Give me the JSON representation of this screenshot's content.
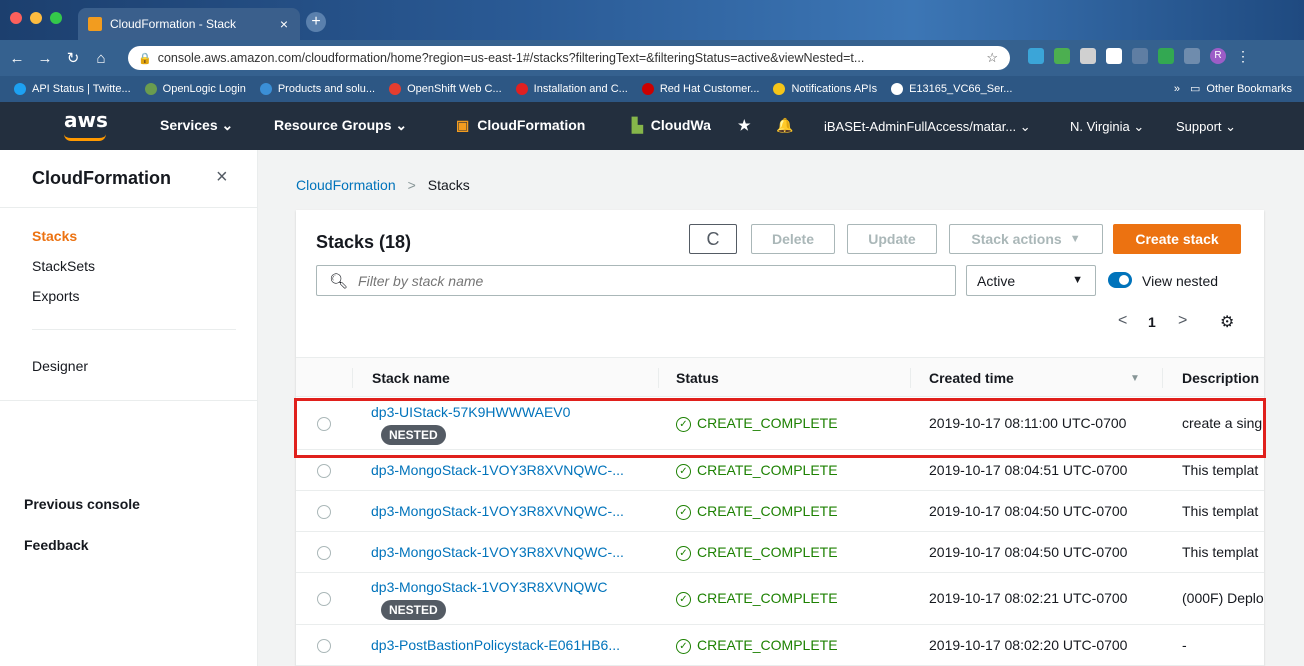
{
  "browser": {
    "tab_title": "CloudFormation - Stack",
    "tab_close": "×",
    "new_tab": "+",
    "url": "console.aws.amazon.com/cloudformation/home?region=us-east-1#/stacks?filteringText=&filteringStatus=active&viewNested=t...",
    "bookmarks": [
      "API Status | Twitte...",
      "OpenLogic Login",
      "Products and solu...",
      "OpenShift Web C...",
      "Installation and C...",
      "Red Hat Customer...",
      "Notifications APIs",
      "E13165_VC66_Ser..."
    ],
    "other_bookmarks": "Other Bookmarks",
    "overflow": "»",
    "profile_initial": "R"
  },
  "awsnav": {
    "logo": "aws",
    "services": "Services",
    "resource_groups": "Resource Groups",
    "cloudformation": "CloudFormation",
    "cloudwatch": "CloudWa",
    "account": "iBASEt-AdminFullAccess/matar...",
    "region": "N. Virginia",
    "support": "Support"
  },
  "sidebar": {
    "title": "CloudFormation",
    "close": "×",
    "items": [
      "Stacks",
      "StackSets",
      "Exports"
    ],
    "designer": "Designer",
    "previous_console": "Previous console",
    "feedback": "Feedback"
  },
  "breadcrumb": {
    "root": "CloudFormation",
    "sep": ">",
    "current": "Stacks"
  },
  "panel": {
    "title": "Stacks (18)",
    "refresh": "C",
    "delete": "Delete",
    "update": "Update",
    "stack_actions": "Stack actions",
    "create": "Create stack",
    "search_placeholder": "Filter by stack name",
    "status_filter": "Active",
    "view_nested": "View nested",
    "page": "1",
    "prev": "<",
    "next": ">",
    "gear": "⚙"
  },
  "table": {
    "columns": [
      "Stack name",
      "Status",
      "Created time",
      "Description"
    ],
    "sort_caret": "▼",
    "rows": [
      {
        "name": "dp3-UIStack-57K9HWWWAEV0",
        "nested": "NESTED",
        "status": "CREATE_COMPLETE",
        "created": "2019-10-17 08:11:00 UTC-0700",
        "desc": "create a sing"
      },
      {
        "name": "dp3-MongoStack-1VOY3R8XVNQWC-...",
        "nested": "",
        "status": "CREATE_COMPLETE",
        "created": "2019-10-17 08:04:51 UTC-0700",
        "desc": "This templat"
      },
      {
        "name": "dp3-MongoStack-1VOY3R8XVNQWC-...",
        "nested": "",
        "status": "CREATE_COMPLETE",
        "created": "2019-10-17 08:04:50 UTC-0700",
        "desc": "This templat"
      },
      {
        "name": "dp3-MongoStack-1VOY3R8XVNQWC-...",
        "nested": "",
        "status": "CREATE_COMPLETE",
        "created": "2019-10-17 08:04:50 UTC-0700",
        "desc": "This templat"
      },
      {
        "name": "dp3-MongoStack-1VOY3R8XVNQWC",
        "nested": "NESTED",
        "status": "CREATE_COMPLETE",
        "created": "2019-10-17 08:02:21 UTC-0700",
        "desc": "(000F) Deplo"
      },
      {
        "name": "dp3-PostBastionPolicystack-E061HB6...",
        "nested": "",
        "status": "CREATE_COMPLETE",
        "created": "2019-10-17 08:02:20 UTC-0700",
        "desc": "-"
      }
    ]
  },
  "colors": {
    "aws_nav": "#232f3e",
    "accent_orange": "#ec7211",
    "link_blue": "#0073bb",
    "success_green": "#1d8102",
    "highlight_red": "#e0201c"
  }
}
